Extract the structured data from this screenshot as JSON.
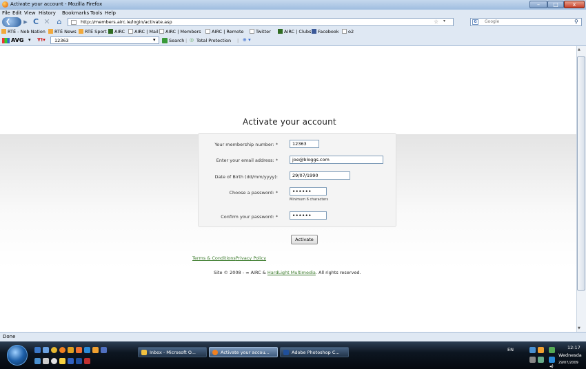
{
  "window": {
    "title": "Activate your account - Mozilla Firefox",
    "minimize_glyph": "–",
    "maximize_glyph": "□",
    "close_glyph": "x"
  },
  "menu": [
    "File",
    "Edit",
    "View",
    "History",
    "Bookmarks",
    "Tools",
    "Help"
  ],
  "nav": {
    "url": "http://members.airc.ie/login/activate.asp",
    "search_placeholder": "Google",
    "back_glyph": "❮",
    "forward_glyph": "▸",
    "reload_glyph": "C",
    "stop_glyph": "✕",
    "home_glyph": "⌂"
  },
  "bookmarks": [
    "RTÉ - Nob Nation",
    "RTÉ News",
    "RTÉ Sport",
    "AIRC",
    "AIRC | Mail",
    "AIRC | Members",
    "AIRC | Remote",
    "Twitter",
    "AIRC | Clubs",
    "Facebook",
    "o2"
  ],
  "avg": {
    "brand": "AVG",
    "dropdown_value": "12363",
    "search_label": "Search",
    "protection_label": "Total Protection"
  },
  "page": {
    "heading": "Activate your account",
    "form": {
      "membership_label": "Your membership number: *",
      "membership_value": "12363",
      "email_label": "Enter your email address: *",
      "email_value": "joe@bloggs.com",
      "dob_label": "Date of Birth (dd/mm/yyyy):",
      "dob_value": "29/07/1990",
      "password_label": "Choose a password: *",
      "password_value": "••••••",
      "password_hint": "Minimum 6 characters",
      "confirm_label": "Confirm your password: *",
      "confirm_value": "••••••"
    },
    "activate_button": "Activate",
    "terms_link": "Terms & Conditions",
    "privacy_link": "Privacy Policy",
    "copyright_prefix": "Site © 2008 - ∞ AIRC & ",
    "hardlight_link": "HardLight Multimedia",
    "copyright_suffix": ". All rights reserved."
  },
  "status": {
    "text": "Done"
  },
  "taskbar": {
    "tasks": [
      "Inbox - Microsoft O...",
      "Activate your accou...",
      "Adobe Photoshop C..."
    ],
    "language": "EN",
    "time": "12:17",
    "day": "Wednesda",
    "date": "29/07/2009"
  },
  "colors": {
    "link": "#3a7a2a",
    "accent": "#2c5f9e"
  }
}
